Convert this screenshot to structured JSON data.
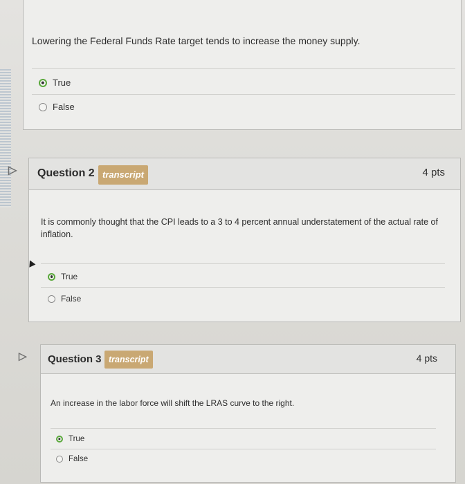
{
  "questions": [
    {
      "text": "Lowering the Federal Funds Rate target tends to increase the money supply.",
      "options": [
        {
          "label": "True",
          "selected": true
        },
        {
          "label": "False",
          "selected": false
        }
      ]
    },
    {
      "title": "Question 2",
      "badge": "transcript",
      "points": "4 pts",
      "text": "It is commonly thought that the CPI leads to a 3 to 4 percent annual understatement of the actual rate of inflation.",
      "options": [
        {
          "label": "True",
          "selected": true
        },
        {
          "label": "False",
          "selected": false
        }
      ]
    },
    {
      "title": "Question 3",
      "badge": "transcript",
      "points": "4 pts",
      "text": "An increase in the labor force will shift the LRAS curve to the right.",
      "options": [
        {
          "label": "True",
          "selected": true
        },
        {
          "label": "False",
          "selected": false
        }
      ]
    }
  ],
  "colors": {
    "badge": "#c9a873",
    "selected_ring": "#5aa83c"
  },
  "icons": [
    "flag-icon",
    "radio-icon"
  ]
}
